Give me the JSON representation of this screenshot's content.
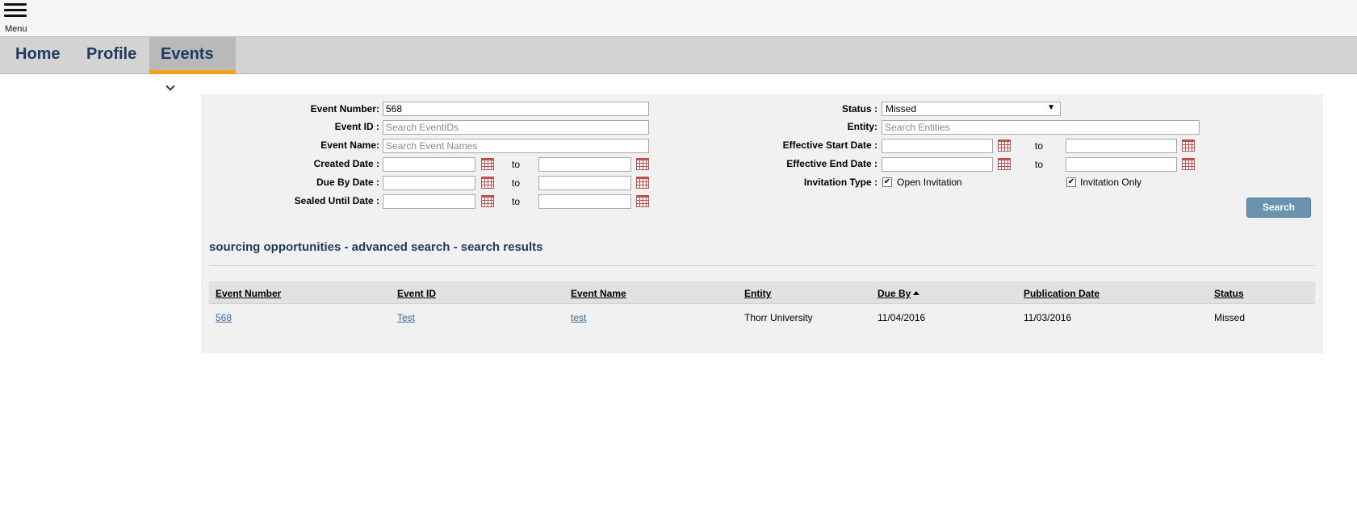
{
  "menu": {
    "label": "Menu"
  },
  "nav": {
    "home": "Home",
    "profile": "Profile",
    "events": "Events"
  },
  "form": {
    "event_number": {
      "label": "Event Number:",
      "value": "568"
    },
    "event_id": {
      "label": "Event ID :",
      "placeholder": "Search EventIDs"
    },
    "event_name": {
      "label": "Event Name:",
      "placeholder": "Search Event Names"
    },
    "created_date": {
      "label": "Created Date :",
      "to": "to"
    },
    "due_by_date": {
      "label": "Due By Date :",
      "to": "to"
    },
    "sealed_until_date": {
      "label": "Sealed Until Date :",
      "to": "to"
    },
    "status": {
      "label": "Status :",
      "value": "Missed"
    },
    "entity": {
      "label": "Entity:",
      "placeholder": "Search Entities"
    },
    "effective_start_date": {
      "label": "Effective Start Date :",
      "to": "to"
    },
    "effective_end_date": {
      "label": "Effective End Date :",
      "to": "to"
    },
    "invitation_type": {
      "label": "Invitation Type :",
      "options": [
        {
          "label": "Open Invitation",
          "checked": true
        },
        {
          "label": "Invitation Only",
          "checked": true
        }
      ]
    },
    "search_button": "Search"
  },
  "results": {
    "title": "sourcing opportunities - advanced search - search results",
    "columns": [
      "Event Number",
      "Event ID",
      "Event Name",
      "Entity",
      "Due By",
      "Publication Date",
      "Status"
    ],
    "sorted_column": "Due By",
    "sort_direction": "ascending",
    "rows": [
      {
        "event_number": "568",
        "event_id": "Test",
        "event_name": "test",
        "entity": "Thorr University",
        "due_by": "11/04/2016",
        "publication_date": "11/03/2016",
        "status": "Missed"
      }
    ]
  },
  "colors": {
    "accent": "#f0a11d",
    "nav_text": "#1f3a5f",
    "link": "#3d6a9c",
    "button": "#6a93b2"
  }
}
